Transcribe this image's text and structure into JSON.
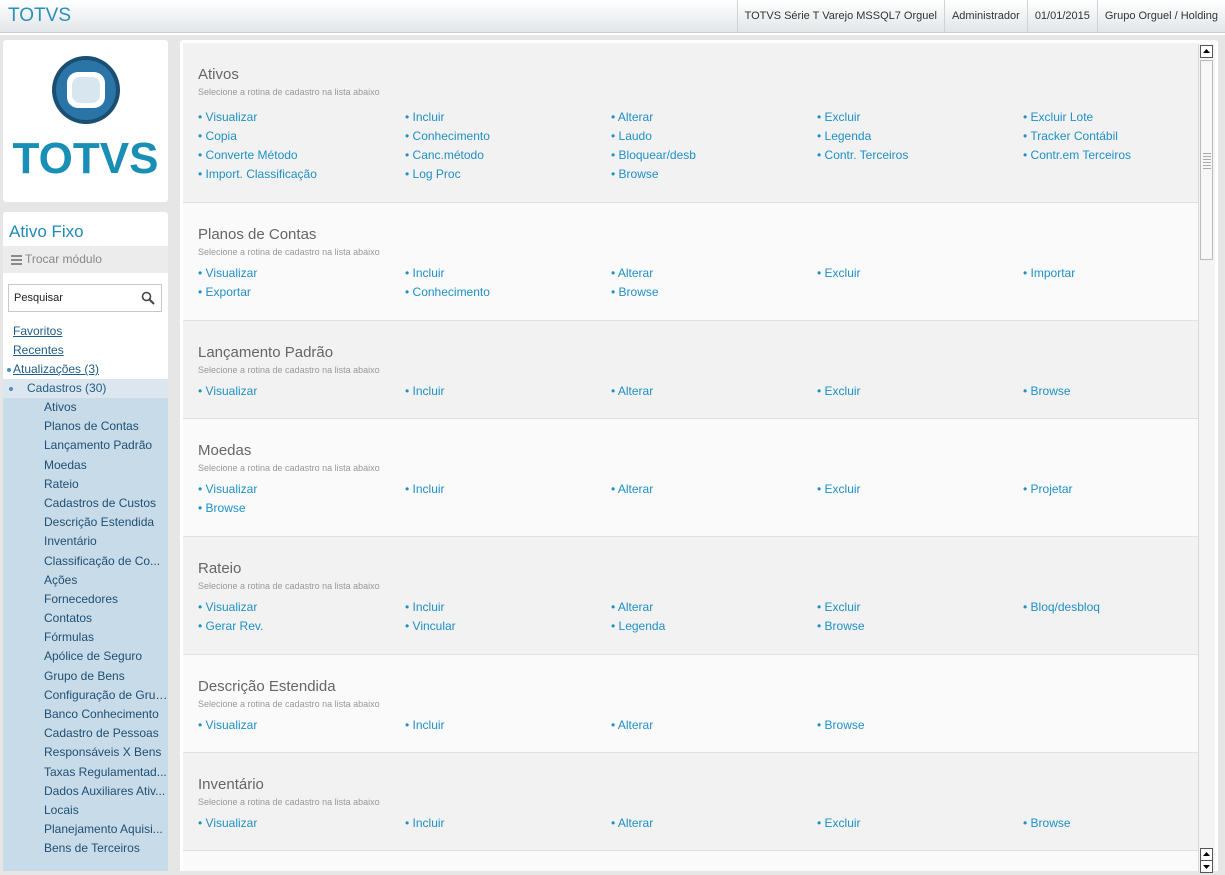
{
  "header": {
    "app_title": "TOTVS",
    "info": [
      "TOTVS Série T Varejo MSSQL7 Orguel",
      "Administrador",
      "01/01/2015",
      "Grupo Orguel / Holding"
    ]
  },
  "logo": {
    "text": "TOTVS"
  },
  "colors": {
    "accent": "#1f8bb8",
    "link": "#1f90c4",
    "tree_bg": "#c8dbe8"
  },
  "sidebar": {
    "module_title": "Ativo Fixo",
    "switch_module": "Trocar módulo",
    "search_placeholder": "Pesquisar",
    "favoritos": "Favoritos",
    "recentes": "Recentes",
    "atualizacoes": "Atualizações (3)",
    "cadastros": "Cadastros (30)",
    "tree": [
      "Ativos",
      "Planos de Contas",
      "Lançamento Padrão",
      "Moedas",
      "Rateio",
      "Cadastros de Custos",
      "Descrição Estendida",
      "Inventário",
      "Classificação de Co...",
      "Ações",
      "Fornecedores",
      "Contatos",
      "Fórmulas",
      "Apólice de Seguro",
      "Grupo de Bens",
      "Configuração de Grupo",
      "Banco Conhecimento",
      "Cadastro de Pessoas",
      "Responsáveis X Bens",
      "Taxas Regulamentad...",
      "Dados Auxiliares Ativ...",
      "Locais",
      "Planejamento Aquisi...",
      "Bens de Terceiros"
    ]
  },
  "sections": [
    {
      "title": "Ativos",
      "subtitle": "Selecione a rotina de cadastro na lista abaixo",
      "links": [
        "• Visualizar",
        "• Incluir",
        "• Alterar",
        "• Excluir",
        "• Excluir Lote",
        "• Copia",
        "• Conhecimento",
        "• Laudo",
        "• Legenda",
        "• Tracker Contábil",
        "• Converte Método",
        "• Canc.método",
        "• Bloquear/desb",
        "• Contr. Terceiros",
        "• Contr.em Terceiros",
        "• Import. Classificação",
        "• Log Proc",
        "• Browse"
      ]
    },
    {
      "title": "Planos de Contas",
      "subtitle": "Selecione a rotina de cadastro na lista abaixo",
      "links": [
        "• Visualizar",
        "• Incluir",
        "• Alterar",
        "• Excluir",
        "• Importar",
        "• Exportar",
        "• Conhecimento",
        "• Browse"
      ]
    },
    {
      "title": "Lançamento Padrão",
      "subtitle": "Selecione a rotina de cadastro na lista abaixo",
      "links": [
        "• Visualizar",
        "• Incluir",
        "• Alterar",
        "• Excluir",
        "• Browse"
      ]
    },
    {
      "title": "Moedas",
      "subtitle": "Selecione a rotina de cadastro na lista abaixo",
      "links": [
        "• Visualizar",
        "• Incluir",
        "• Alterar",
        "• Excluir",
        "• Projetar",
        "• Browse"
      ]
    },
    {
      "title": "Rateio",
      "subtitle": "Selecione a rotina de cadastro na lista abaixo",
      "links": [
        "• Visualizar",
        "• Incluir",
        "• Alterar",
        "• Excluir",
        "• Bloq/desbloq",
        "• Gerar Rev.",
        "• Vincular",
        "• Legenda",
        "• Browse"
      ]
    },
    {
      "title": "Descrição Estendida",
      "subtitle": "Selecione a rotina de cadastro na lista abaixo",
      "links": [
        "• Visualizar",
        "• Incluir",
        "• Alterar",
        "• Browse"
      ]
    },
    {
      "title": "Inventário",
      "subtitle": "Selecione a rotina de cadastro na lista abaixo",
      "links": [
        "• Visualizar",
        "• Incluir",
        "• Alterar",
        "• Excluir",
        "• Browse"
      ]
    }
  ]
}
